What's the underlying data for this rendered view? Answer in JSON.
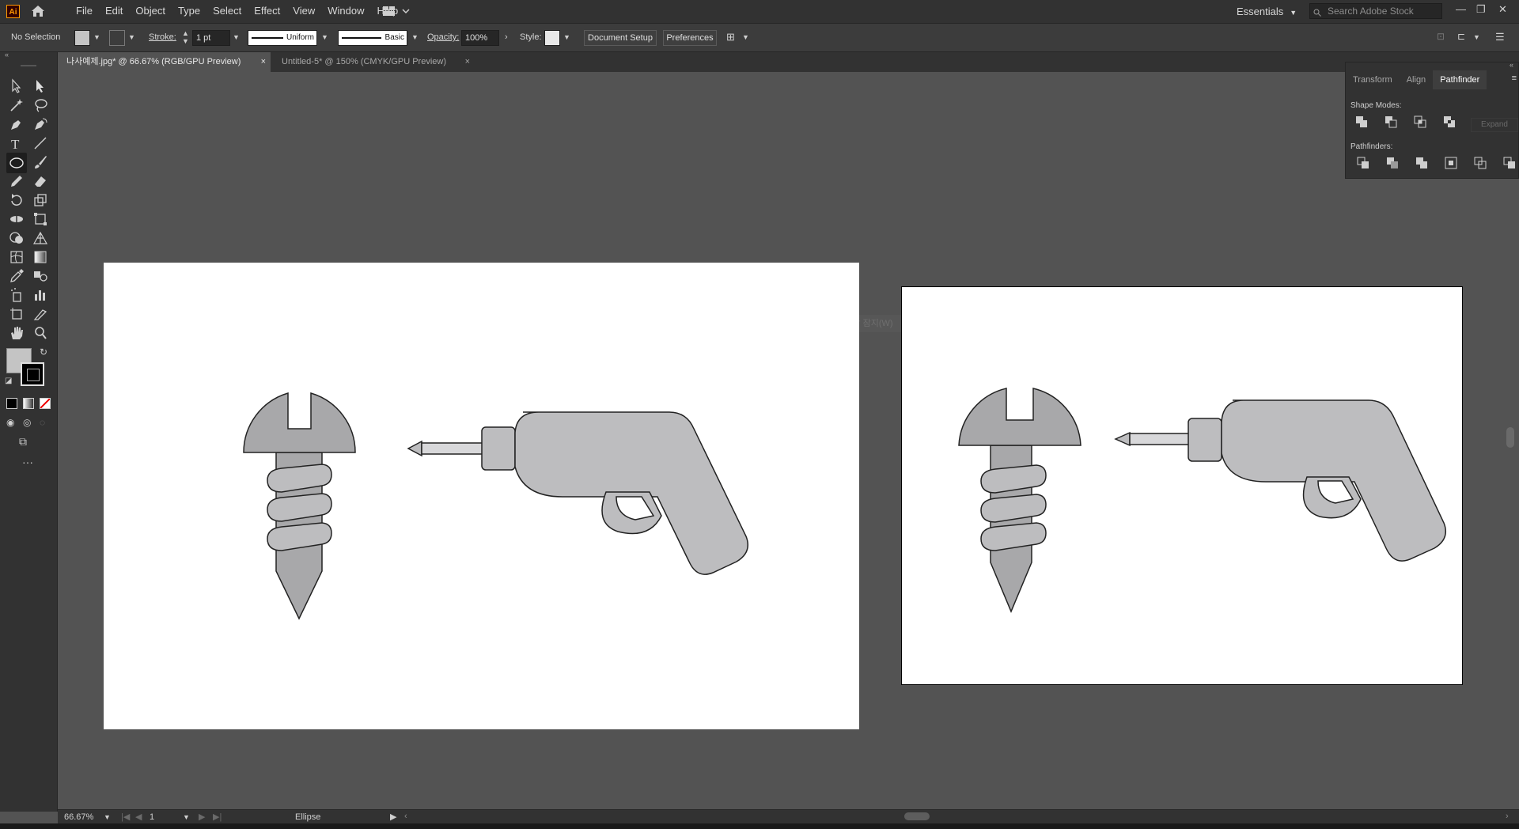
{
  "app": {
    "logo": "Ai"
  },
  "menu": [
    "File",
    "Edit",
    "Object",
    "Type",
    "Select",
    "Effect",
    "View",
    "Window",
    "Help"
  ],
  "workspace": {
    "name": "Essentials"
  },
  "search": {
    "placeholder": "Search Adobe Stock"
  },
  "control": {
    "selection": "No Selection",
    "stroke_label": "Stroke:",
    "stroke_value": "1 pt",
    "profile": "Uniform",
    "brush": "Basic",
    "opacity_label": "Opacity:",
    "opacity_value": "100%",
    "style_label": "Style:",
    "document_setup": "Document Setup",
    "preferences": "Preferences"
  },
  "tabs": [
    {
      "label": "나사예제.jpg* @ 66.67% (RGB/GPU Preview)",
      "close": "×"
    },
    {
      "label": "Untitled-5* @ 150% (CMYK/GPU Preview)",
      "close": "×"
    }
  ],
  "panel": {
    "tabs": [
      "Transform",
      "Align",
      "Pathfinder"
    ],
    "shape_modes": "Shape Modes:",
    "pathfinders": "Pathfinders:",
    "expand": "Expand"
  },
  "status": {
    "zoom": "66.67%",
    "page": "1",
    "tool": "Ellipse"
  },
  "ghost_label": "잠 잠지(W)",
  "colors": {
    "fill_swatch": "#c4c4c4",
    "shape_light": "#bdbdbf",
    "shape_dark": "#a8a8aa",
    "accent": "#ff9a00"
  }
}
